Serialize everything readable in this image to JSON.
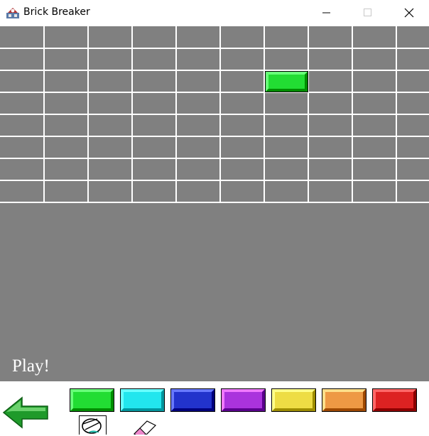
{
  "window": {
    "title": "Brick Breaker",
    "controls": [
      "minimize",
      "maximize",
      "close"
    ]
  },
  "game": {
    "play_label": "Play!",
    "background": "#808080",
    "grid": {
      "rows": 8,
      "columns": 10
    },
    "placed_bricks": [
      {
        "row": 3,
        "column": 7,
        "color": "green"
      }
    ]
  },
  "palette": {
    "back_icon": "green-left-arrow-icon",
    "bricks": [
      {
        "color": "green",
        "hex": "#22dd33"
      },
      {
        "color": "cyan",
        "hex": "#22e6ee"
      },
      {
        "color": "blue",
        "hex": "#2233cc"
      },
      {
        "color": "purple",
        "hex": "#aa33dd"
      },
      {
        "color": "yellow",
        "hex": "#eedd44"
      },
      {
        "color": "orange",
        "hex": "#ee9944"
      },
      {
        "color": "red",
        "hex": "#dd2222"
      }
    ],
    "tools": [
      "paint-bucket-icon",
      "eraser-icon"
    ]
  }
}
